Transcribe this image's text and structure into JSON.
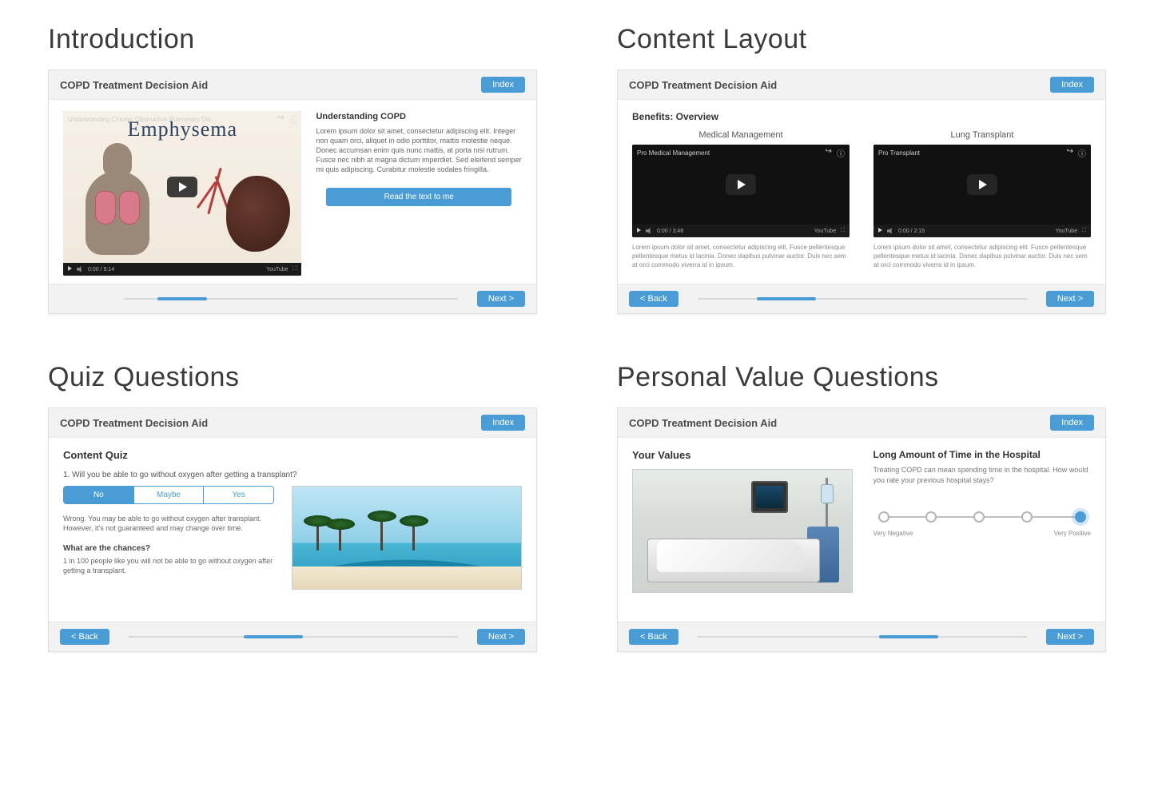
{
  "sections": {
    "intro": "Introduction",
    "content": "Content Layout",
    "quiz": "Quiz Questions",
    "values": "Personal Value Questions"
  },
  "app_title": "COPD Treatment Decision Aid",
  "buttons": {
    "index": "Index",
    "back": "< Back",
    "next": "Next >",
    "read": "Read the text to me"
  },
  "intro": {
    "video_title": "Understanding Chronic Obstructive Pulmonary Dis...",
    "overlay": "Emphysema",
    "time": "0:00 / 9:14",
    "heading": "Understanding COPD",
    "body": "Lorem ipsum dolor sit amet, consectetur adipiscing elit. Integer non quam orci, aliquet in odio porttitor, mattis molestie neque. Donec accumsan enim quis nunc mattis, at porta nisl rutrum. Fusce nec nibh at magna dictum imperdiet. Sed eleifend semper mi quis adipiscing. Curabitur molestie sodales fringilla."
  },
  "content": {
    "title": "Benefits: Overview",
    "col1": {
      "title": "Medical Management",
      "video_title": "Pro Medical Management",
      "time": "0:00 / 3:48",
      "body": "Lorem ipsum dolor sit amet, consectetur adipiscing elit. Fusce pellentesque pellentesque metus id lacinia. Donec dapibus pulvinar auctor. Duis nec sem at orci commodo viverra id in ipsum."
    },
    "col2": {
      "title": "Lung Transplant",
      "video_title": "Pro Transplant",
      "time": "0:00 / 2:15",
      "body": "Lorem ipsum dolor sit amet, consectetur adipiscing elit. Fusce pellentesque pellentesque metus id lacinia. Donec dapibus pulvinar auctor. Duis nec sem at orci commodo viverra id in ipsum."
    }
  },
  "quiz": {
    "title": "Content Quiz",
    "q1": "1. Will you be able to go without oxygen after getting a transplant?",
    "opts": {
      "no": "No",
      "maybe": "Maybe",
      "yes": "Yes"
    },
    "feedback": "Wrong. You may be able to go without oxygen after transplant. However, it's not guaranteed and may change over time.",
    "sub_heading": "What are the chances?",
    "sub_body": "1 in 100 people like you will not be able to go without oxygen after getting a transplant."
  },
  "values": {
    "left_title": "Your Values",
    "right_title": "Long Amount of Time in the Hospital",
    "right_body": "Treating COPD can mean spending time in the hospital. How would you rate your previous hospital stays?",
    "label_neg": "Very Negative",
    "label_pos": "Very Positive"
  }
}
